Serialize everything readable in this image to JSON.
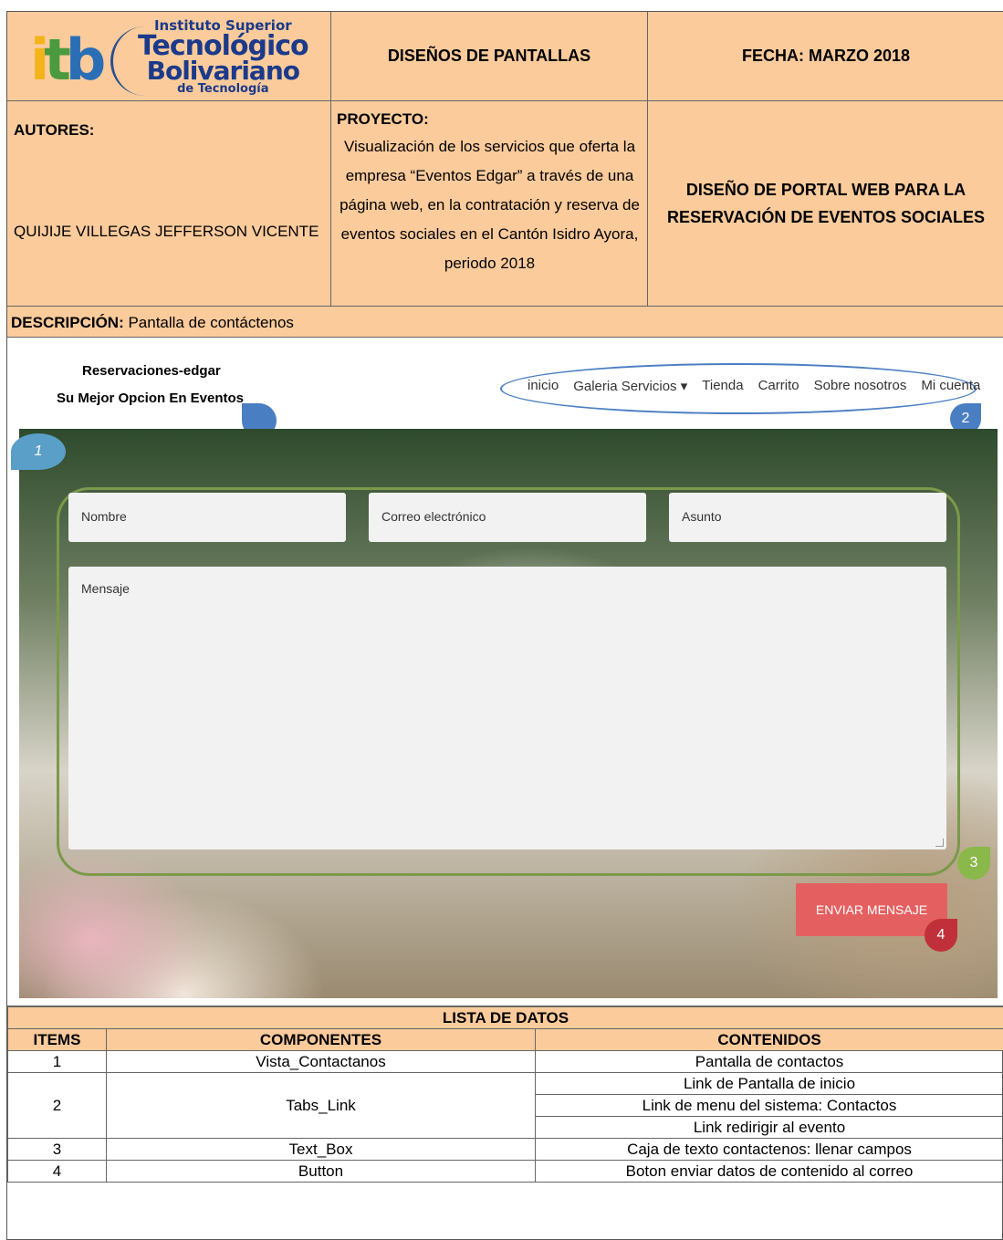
{
  "header": {
    "logo": {
      "itb": "itb",
      "line1": "Instituto Superior",
      "line2": "Tecnológico",
      "line3": "Bolivariano",
      "line4": "de Tecnología"
    },
    "title": "DISEÑOS DE PANTALLAS",
    "date": "FECHA:  MARZO 2018"
  },
  "info": {
    "authors_label": "AUTORES:",
    "author_name": "QUIJIJE VILLEGAS JEFFERSON VICENTE",
    "project_label": "PROYECTO:",
    "project_text": "Visualización de los servicios que oferta la empresa “Eventos Edgar” a través de una página web, en la contratación y reserva de eventos sociales en el Cantón Isidro Ayora, periodo 2018",
    "design_title": "DISEÑO DE PORTAL WEB PARA LA RESERVACIÓN DE EVENTOS SOCIALES"
  },
  "description": {
    "label": "DESCRIPCIÓN:",
    "text": " Pantalla de contáctenos"
  },
  "mockup": {
    "brand_title": "Reservaciones-edgar",
    "brand_subtitle": "Su Mejor Opcion En Eventos",
    "nav": [
      "inicio",
      "Galeria Servicios ▾",
      "Tienda",
      "Carrito",
      "Sobre nosotros",
      "Mi cuenta"
    ],
    "fields": {
      "nombre_placeholder": "Nombre",
      "correo_placeholder": "Correo electrónico",
      "asunto_placeholder": "Asunto",
      "mensaje_placeholder": "Mensaje"
    },
    "send_button": "ENVIAR MENSAJE",
    "markers": [
      "1",
      "2",
      "3",
      "4"
    ],
    "colors": {
      "header_fill": "#fbcb9c",
      "marker_blue": "#4a7ec2",
      "marker_green": "#8ab84a",
      "marker_red": "#c0303a",
      "send_button": "#e46060"
    }
  },
  "table": {
    "title": "LISTA DE DATOS",
    "columns": [
      "ITEMS",
      "COMPONENTES",
      "CONTENIDOS"
    ],
    "rows": [
      {
        "item": "1",
        "component": "Vista_Contactanos",
        "contents": [
          "Pantalla de contactos"
        ]
      },
      {
        "item": "2",
        "component": "Tabs_Link",
        "contents": [
          "Link de Pantalla de inicio",
          "Link de menu del sistema: Contactos",
          "Link redirigir al evento"
        ]
      },
      {
        "item": "3",
        "component": "Text_Box",
        "contents": [
          "Caja de texto contactenos: llenar campos"
        ]
      },
      {
        "item": "4",
        "component": "Button",
        "contents": [
          "Boton enviar datos de contenido al correo"
        ]
      }
    ]
  }
}
